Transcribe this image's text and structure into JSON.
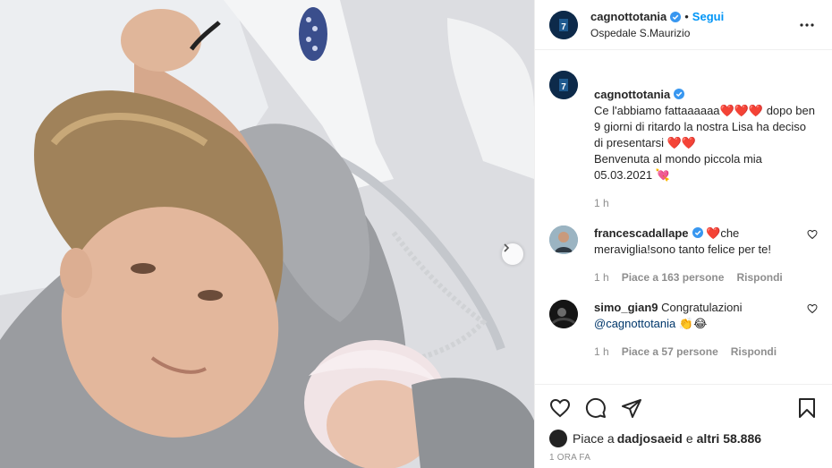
{
  "post": {
    "username": "cagnottotania",
    "follow_label": "Segui",
    "location": "Ospedale S.Maurizio",
    "separator": "•"
  },
  "caption": {
    "username": "cagnottotania",
    "text": "Ce l'abbiamo fattaaaaaa❤️❤️❤️ dopo ben 9 giorni di ritardo la nostra Lisa ha deciso di presentarsi ❤️❤️\nBenvenuta al mondo piccola mia 05.03.2021 💘",
    "time": "1 h"
  },
  "comments": [
    {
      "username": "francescadallape",
      "text": "❤️che meraviglia!sono tanto felice per te!",
      "time": "1 h",
      "likes": "Piace a 163 persone",
      "reply": "Rispondi"
    },
    {
      "username": "simo_gian9",
      "text": "Congratulazioni",
      "mention": "@cagnottotania",
      "emoji": "👏😂",
      "time": "1 h",
      "likes": "Piace a 57 persone",
      "reply": "Rispondi"
    }
  ],
  "likes_line": {
    "prefix": "Piace a ",
    "user": "dadjosaeid",
    "middle": " e ",
    "others": "altri 58.886"
  },
  "timestamp": "1 ORA FA",
  "colors": {
    "accent": "#0095f6",
    "verified": "#3897f0",
    "text": "#262626",
    "muted": "#8e8e8e"
  },
  "icons": [
    "more-icon",
    "verified-icon",
    "heart-icon",
    "comment-icon",
    "share-icon",
    "bookmark-icon",
    "chevron-right-icon"
  ]
}
